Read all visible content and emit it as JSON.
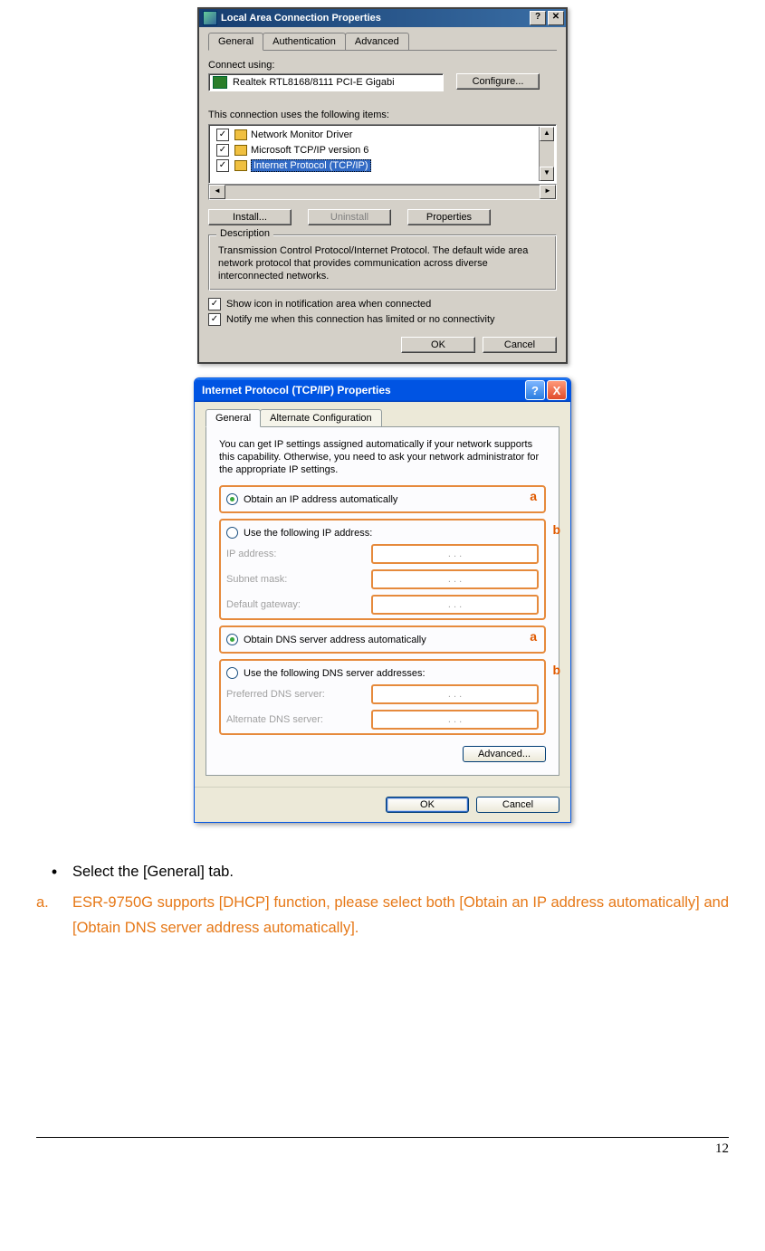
{
  "dialog1": {
    "title": "Local Area Connection Properties",
    "help_btn": "?",
    "close_btn": "✕",
    "tabs": {
      "general": "General",
      "auth": "Authentication",
      "advanced": "Advanced"
    },
    "connect_using_label": "Connect using:",
    "adapter": "Realtek RTL8168/8111 PCI-E Gigabi",
    "configure_btn": "Configure...",
    "items_label": "This connection uses the following items:",
    "items": {
      "i0": "Network Monitor Driver",
      "i1": "Microsoft TCP/IP version 6",
      "i2": "Internet Protocol (TCP/IP)"
    },
    "install_btn": "Install...",
    "uninstall_btn": "Uninstall",
    "properties_btn": "Properties",
    "desc_legend": "Description",
    "desc_text": "Transmission Control Protocol/Internet Protocol. The default wide area network protocol that provides communication across diverse interconnected networks.",
    "chk_show": "Show icon in notification area when connected",
    "chk_notify": "Notify me when this connection has limited or no connectivity",
    "ok_btn": "OK",
    "cancel_btn": "Cancel",
    "scroll_up": "▲",
    "scroll_down": "▼",
    "scroll_left": "◄",
    "scroll_right": "►",
    "chk_mark": "✓"
  },
  "dialog2": {
    "title": "Internet Protocol (TCP/IP) Properties",
    "help_btn": "?",
    "close_btn": "X",
    "tabs": {
      "general": "General",
      "alt": "Alternate Configuration"
    },
    "info": "You can get IP settings assigned automatically if your network supports this capability. Otherwise, you need to ask your network administrator for the appropriate IP settings.",
    "obtain_ip": "Obtain an IP address automatically",
    "use_ip": "Use the following IP address:",
    "ip_address_lbl": "IP address:",
    "subnet_lbl": "Subnet mask:",
    "gateway_lbl": "Default gateway:",
    "obtain_dns": "Obtain DNS server address automatically",
    "use_dns": "Use the following DNS server addresses:",
    "pref_dns_lbl": "Preferred DNS server:",
    "alt_dns_lbl": "Alternate DNS server:",
    "advanced_btn": "Advanced...",
    "ok_btn": "OK",
    "cancel_btn": "Cancel",
    "ip_dots": ".       .       .",
    "ann_a": "a",
    "ann_b": "b"
  },
  "bodytext": {
    "line1": "Select the [General] tab.",
    "line2": "ESR-9750G supports [DHCP] function, please select both [Obtain an IP address automatically] and [Obtain DNS server address automatically].",
    "marker_a": "a."
  },
  "page_number": "12",
  "bullet": "•"
}
